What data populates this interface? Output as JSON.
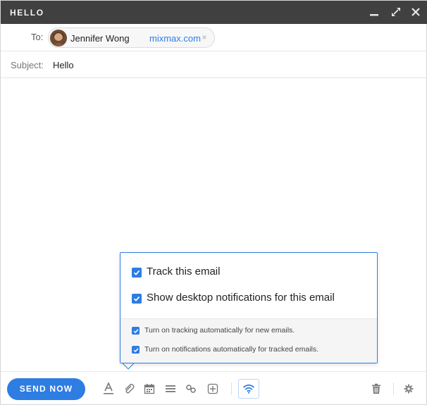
{
  "window": {
    "title": "HELLO",
    "controls": {
      "minimize_icon": "minimize-icon",
      "expand_icon": "expand-icon",
      "close_icon": "close-icon"
    }
  },
  "to": {
    "label": "To:",
    "recipient": {
      "name": "Jennifer Wong",
      "domain": "mixmax.com",
      "remove": "×"
    }
  },
  "subject": {
    "label": "Subject:",
    "value": "Hello"
  },
  "tracking_popover": {
    "options": [
      {
        "label": "Track this email",
        "checked": true
      },
      {
        "label": "Show desktop notifications for this email",
        "checked": true
      }
    ],
    "defaults": [
      {
        "label": "Turn on tracking automatically for new emails.",
        "checked": true
      },
      {
        "label": "Turn on notifications automatically for tracked emails.",
        "checked": true
      }
    ]
  },
  "toolbar": {
    "send_label": "SEND NOW",
    "icons": [
      "text-format-icon",
      "attachment-icon",
      "calendar-icon",
      "list-icon",
      "link-icon",
      "insert-icon",
      "tracking-icon",
      "trash-icon",
      "gear-icon"
    ]
  },
  "colors": {
    "accent": "#2d7de3",
    "titlebar": "#404040",
    "link": "#2d7de3"
  }
}
